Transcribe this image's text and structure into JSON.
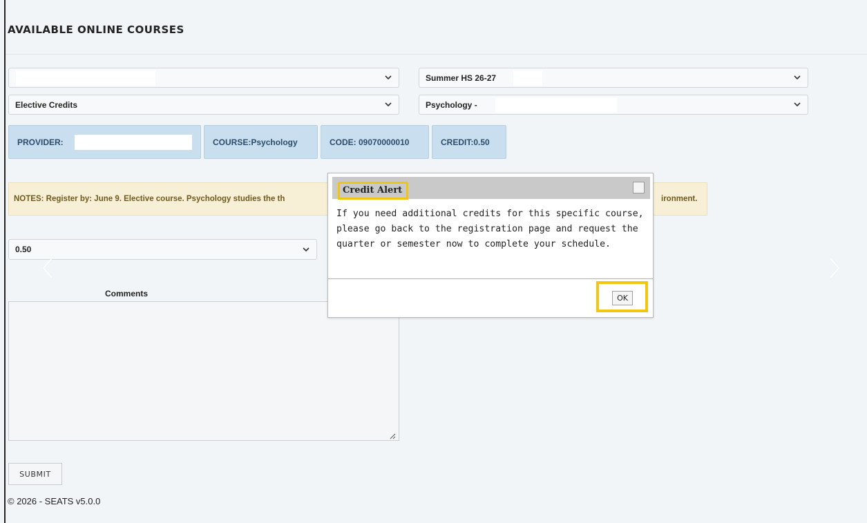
{
  "page": {
    "title": "AVAILABLE ONLINE COURSES"
  },
  "filters": {
    "school_select": {
      "value": ""
    },
    "term_select": {
      "value": "Summer HS 26-27"
    },
    "category_select": {
      "value": "Elective Credits"
    },
    "course_select": {
      "value": "Psychology -"
    }
  },
  "course_info": {
    "provider_label": "PROVIDER:",
    "course": "COURSE:Psychology",
    "code": "CODE: 09070000010",
    "credit": "CREDIT:0.50"
  },
  "notes": {
    "text_start": "NOTES: Register by: June 9. Elective course. Psychology studies the th",
    "text_end": "ironment."
  },
  "credit_select": {
    "value": "0.50"
  },
  "comments": {
    "label": "Comments",
    "value": ""
  },
  "submit_label": "SUBMIT",
  "footer": "© 2026 - SEATS v5.0.0",
  "dialog": {
    "title": "Credit Alert",
    "lines": [
      "If you need additional credits for this specific course,",
      "please go back to the registration page and request the",
      "quarter or semester now to complete your schedule."
    ],
    "ok_label": "OK"
  },
  "colors": {
    "highlight": "#f2c511",
    "chip_bg": "#c9deee",
    "notes_bg": "#f8f0d6"
  }
}
